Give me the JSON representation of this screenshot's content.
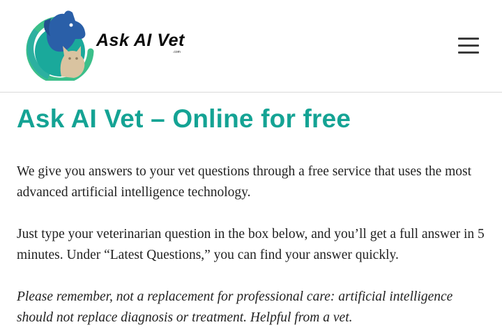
{
  "header": {
    "brand_name": "Ask AI Vet",
    "brand_suffix": ".com",
    "logo_icon": "dog-cat-circle-logo-icon",
    "menu_icon": "hamburger-menu-icon"
  },
  "colors": {
    "accent_teal": "#14a394",
    "logo_blue": "#2a5fa8",
    "logo_green": "#3bbf8a",
    "logo_tan": "#d9c3a0"
  },
  "main": {
    "title": "Ask AI Vet – Online for free",
    "paragraphs": [
      "We give you answers to your vet questions through a free service that uses the most advanced artificial intelligence technology.",
      "Just type your veterinarian question in the box below, and you’ll get a full answer in 5 minutes. Under “Latest Questions,” you can find your answer quickly.",
      "Please remember, not a replacement for professional care: artificial intelligence should not replace diagnosis or treatment. Helpful from a vet."
    ]
  }
}
